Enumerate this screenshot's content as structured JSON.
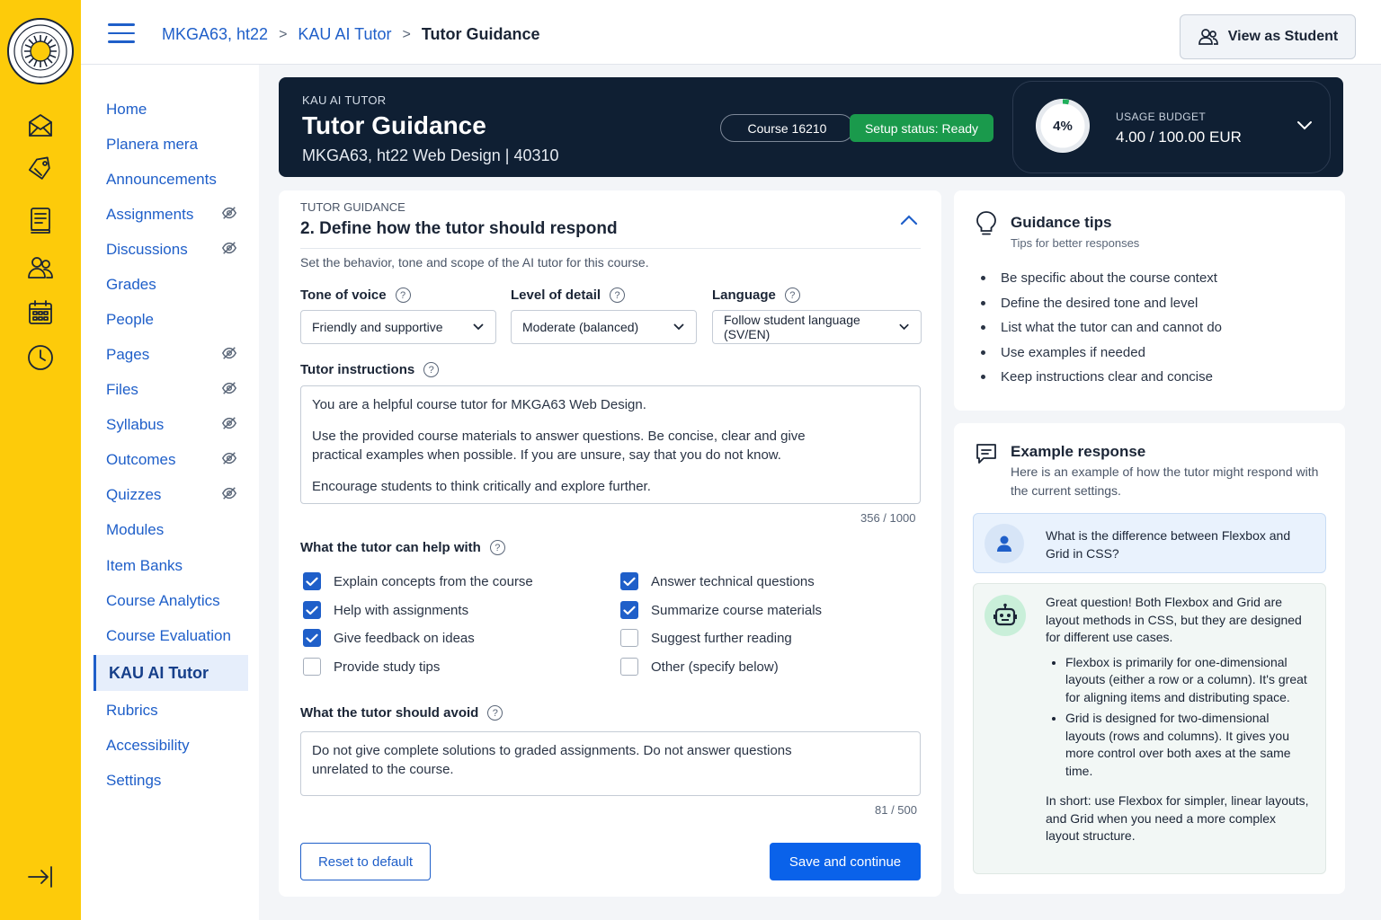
{
  "breadcrumb": {
    "course": "MKGA63, ht22",
    "tool": "KAU AI Tutor",
    "page": "Tutor Guidance"
  },
  "top_actions": {
    "view_as_student": "View as Student"
  },
  "course_nav": [
    {
      "label": "Home",
      "hidden": false
    },
    {
      "label": "Planera mera",
      "hidden": false
    },
    {
      "label": "Announcements",
      "hidden": false
    },
    {
      "label": "Assignments",
      "hidden": true
    },
    {
      "label": "Discussions",
      "hidden": true
    },
    {
      "label": "Grades",
      "hidden": false
    },
    {
      "label": "People",
      "hidden": false
    },
    {
      "label": "Pages",
      "hidden": true
    },
    {
      "label": "Files",
      "hidden": true
    },
    {
      "label": "Syllabus",
      "hidden": true
    },
    {
      "label": "Outcomes",
      "hidden": true
    },
    {
      "label": "Quizzes",
      "hidden": true
    },
    {
      "label": "Modules",
      "hidden": false
    },
    {
      "label": "Item Banks",
      "hidden": false
    },
    {
      "label": "Course Analytics",
      "hidden": false
    },
    {
      "label": "Course Evaluation",
      "hidden": false
    },
    {
      "label": "KAU AI Tutor",
      "hidden": false,
      "active": true
    },
    {
      "label": "Rubrics",
      "hidden": false
    },
    {
      "label": "Accessibility",
      "hidden": false
    },
    {
      "label": "Settings",
      "hidden": false
    }
  ],
  "global_nav_icons": [
    "inbox-icon",
    "tag-icon",
    "document-icon",
    "people-icon",
    "calendar-icon",
    "clock-icon",
    "collapse-sidebar-icon"
  ],
  "header": {
    "kicker": "KAU AI TUTOR",
    "title": "Tutor Guidance",
    "subtitle": "MKGA63, ht22 Web Design | 40310",
    "course_pill": "Course 16210",
    "status_pill": "Setup status: Ready",
    "usage": {
      "percent_label": "4%",
      "percent": 4,
      "label": "USAGE BUDGET",
      "value": "4.00 / 100.00 EUR"
    }
  },
  "form": {
    "kicker": "TUTOR GUIDANCE",
    "title": "2. Define how the tutor should respond",
    "description": "Set the behavior, tone and scope of the AI tutor for this course.",
    "tone": {
      "label": "Tone of voice",
      "value": "Friendly and supportive"
    },
    "detail": {
      "label": "Level of detail",
      "value": "Moderate (balanced)"
    },
    "language": {
      "label": "Language",
      "value": "Follow student language (SV/EN)"
    },
    "instructions": {
      "label": "Tutor instructions",
      "p1": "You are a helpful course tutor for MKGA63 Web Design.",
      "p2": "Use the provided course materials to answer questions. Be concise, clear and give practical examples when possible. If you are unsure, say that you do not know.",
      "p3": "Encourage students to think critically and explore further.",
      "counter": "356 / 1000"
    },
    "help_with": {
      "label": "What the tutor can help with",
      "options": [
        {
          "label": "Explain concepts from the course",
          "checked": true
        },
        {
          "label": "Help with assignments",
          "checked": true
        },
        {
          "label": "Give feedback on ideas",
          "checked": true
        },
        {
          "label": "Provide study tips",
          "checked": false
        },
        {
          "label": "Answer technical questions",
          "checked": true
        },
        {
          "label": "Summarize course materials",
          "checked": true
        },
        {
          "label": "Suggest further reading",
          "checked": false
        },
        {
          "label": "Other (specify below)",
          "checked": false
        }
      ]
    },
    "avoid": {
      "label": "What the tutor should avoid",
      "text": "Do not give complete solutions to graded assignments. Do not answer questions unrelated to the course.",
      "counter": "81 / 500"
    },
    "reset_label": "Reset to default",
    "save_label": "Save and continue"
  },
  "tips": {
    "title": "Guidance tips",
    "subtitle": "Tips for better responses",
    "items": [
      "Be specific about the course context",
      "Define the desired tone and level",
      "List what the tutor can and cannot do",
      "Use examples if needed",
      "Keep instructions clear and concise"
    ]
  },
  "example": {
    "title": "Example response",
    "subtitle": "Here is an example of how the tutor might respond with the current settings.",
    "question": "What is the difference between Flexbox and Grid in CSS?",
    "answer_intro": "Great question! Both Flexbox and Grid are layout methods in CSS, but they are designed for different use cases.",
    "answer_points": [
      "Flexbox is primarily for one-dimensional layouts (either a row or a column). It's great for aligning items and distributing space.",
      "Grid is designed for two-dimensional layouts (rows and columns). It gives you more control over both axes at the same time."
    ],
    "answer_summary": "In short: use Flexbox for simpler, linear layouts, and Grid when you need a more complex layout structure."
  },
  "colors": {
    "rail": "#fdcb0a",
    "link": "#1f5fc9",
    "banner": "#0f1f33",
    "status_ready": "#1a9a4c",
    "primary_button": "#0a62ea"
  }
}
